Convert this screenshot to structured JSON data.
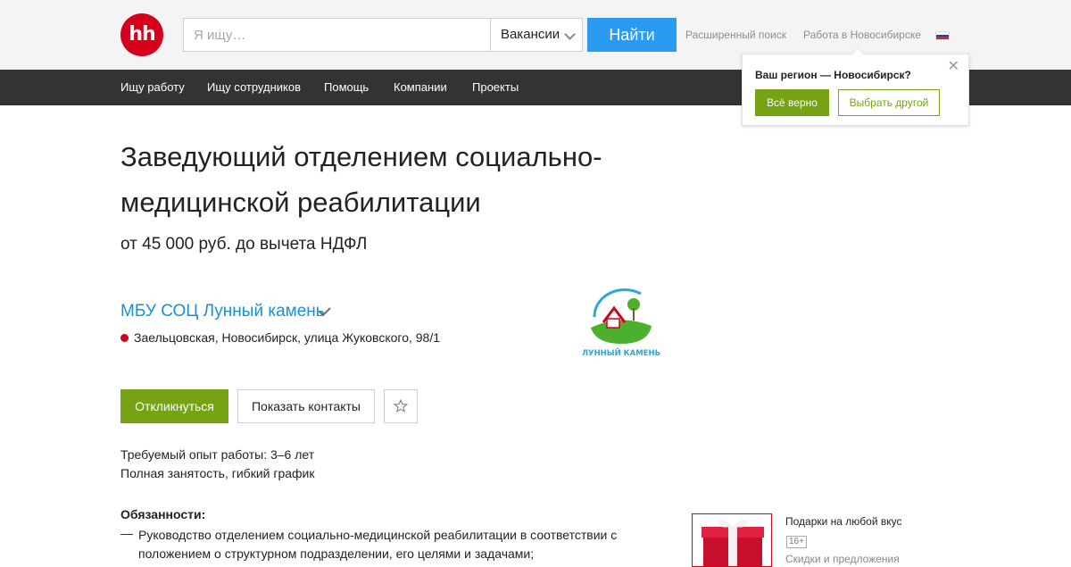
{
  "header": {
    "logo_text": "hh",
    "search": {
      "placeholder": "Я ищу…",
      "value": ""
    },
    "search_type": "Вакансии",
    "search_button": "Найти",
    "advanced_search": "Расширенный поиск",
    "region_link": "Работа в Новосибирске",
    "flag_colors": [
      "#ffffff",
      "#1c3fa8",
      "#d52b1e"
    ]
  },
  "nav": {
    "items": [
      "Ищу работу",
      "Ищу сотрудников",
      "Помощь",
      "Компании",
      "Проекты"
    ]
  },
  "region_popup": {
    "title": "Ваш регион — Новосибирск?",
    "confirm": "Всё верно",
    "other": "Выбрать другой"
  },
  "vacancy": {
    "title": "Заведующий отделением социально-медицинской реабилитации",
    "salary": "от 45 000 руб. до вычета НДФЛ",
    "company": "МБУ СОЦ Лунный камень",
    "address": "Заельцовская, Новосибирск, улица Жуковского, 98/1",
    "logo_caption": "ЛУННЫЙ КАМЕНЬ",
    "respond_button": "Откликнуться",
    "contacts_button": "Показать контакты",
    "experience": "Требуемый опыт работы: 3–6 лет",
    "employment": "Полная занятость, гибкий график",
    "duties_heading": "Обязанности:",
    "duty_dash": "—",
    "duties": [
      "Руководство отделением социально-медицинской реабилитации в соответствии с положением о структурном подразделении, его целями и задачами;"
    ]
  },
  "ad": {
    "title": "Подарки на любой вкус",
    "age": "16+",
    "subtitle": "Скидки и предложения"
  },
  "colors": {
    "brand_red": "#d6001c",
    "search_blue": "#2a9bf0",
    "action_green": "#75a313",
    "link_blue": "#1890d6",
    "nav_dark": "#333333"
  }
}
